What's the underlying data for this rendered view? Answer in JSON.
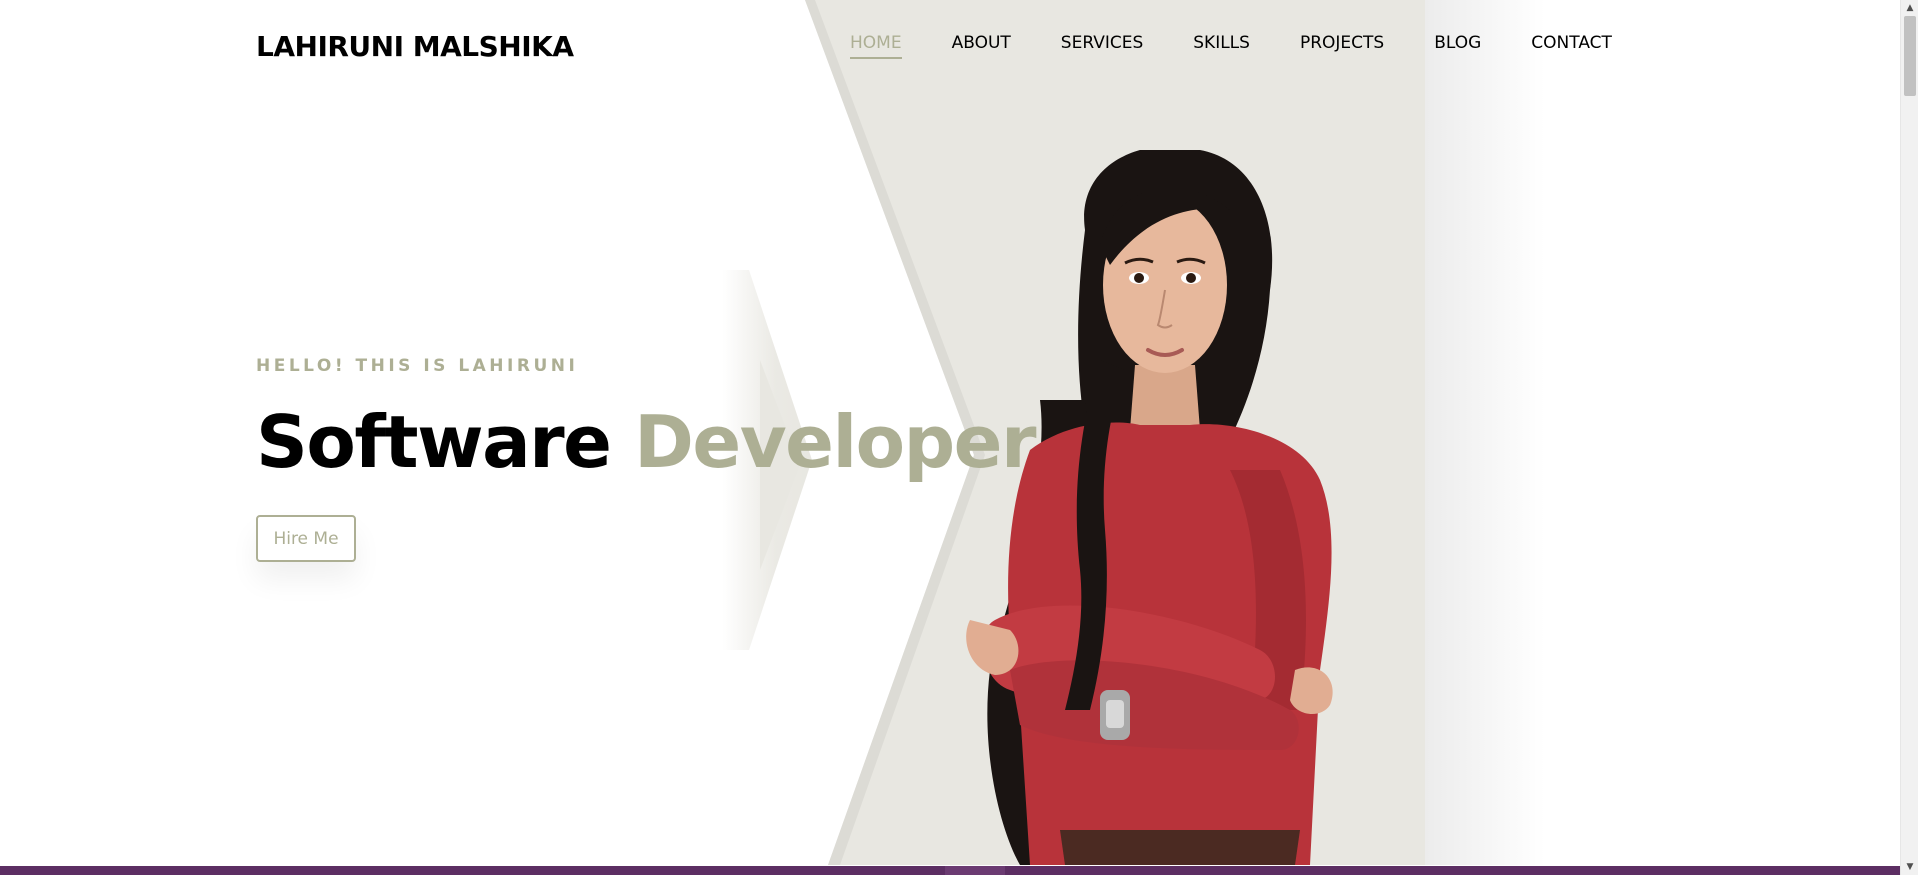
{
  "header": {
    "brand": "LAHIRUNI MALSHIKA",
    "nav": [
      {
        "label": "HOME",
        "active": true
      },
      {
        "label": "ABOUT",
        "active": false
      },
      {
        "label": "SERVICES",
        "active": false
      },
      {
        "label": "SKILLS",
        "active": false
      },
      {
        "label": "PROJECTS",
        "active": false
      },
      {
        "label": "BLOG",
        "active": false
      },
      {
        "label": "CONTACT",
        "active": false
      }
    ]
  },
  "hero": {
    "greeting": "HELLO! THIS IS LAHIRUNI",
    "title_part1": "Software",
    "title_part2": "Developer",
    "cta_label": "Hire Me",
    "portrait_icon": "person-portrait-icon"
  },
  "colors": {
    "accent": "#adaf94",
    "hero_panel": "#e8e7e1",
    "text": "#000000",
    "bottom_strip": "#5c2e63",
    "shirt": "#b8333a",
    "hair": "#1a1412",
    "skin": "#e7b89c"
  }
}
